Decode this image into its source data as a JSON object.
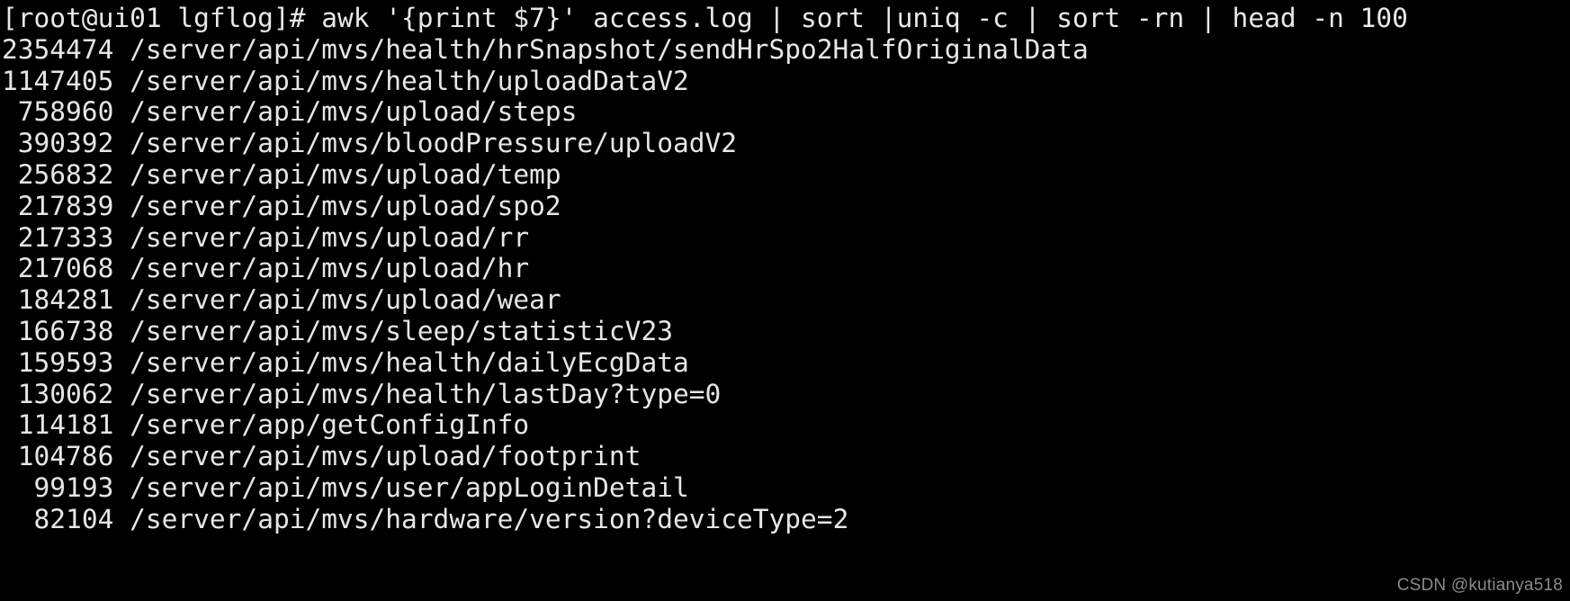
{
  "terminal": {
    "prompt": "[root@ui01 lgflog]#",
    "command": "awk '{print $7}' access.log | sort |uniq -c | sort -rn | head -n 100",
    "command_line": "[root@ui01 lgflog]# awk '{print $7}' access.log | sort |uniq -c | sort -rn | head -n 100",
    "count_width": 7,
    "rows": [
      {
        "count": "2354474",
        "path": "/server/api/mvs/health/hrSnapshot/sendHrSpo2HalfOriginalData"
      },
      {
        "count": "1147405",
        "path": "/server/api/mvs/health/uploadDataV2"
      },
      {
        "count": "758960",
        "path": "/server/api/mvs/upload/steps"
      },
      {
        "count": "390392",
        "path": "/server/api/mvs/bloodPressure/uploadV2"
      },
      {
        "count": "256832",
        "path": "/server/api/mvs/upload/temp"
      },
      {
        "count": "217839",
        "path": "/server/api/mvs/upload/spo2"
      },
      {
        "count": "217333",
        "path": "/server/api/mvs/upload/rr"
      },
      {
        "count": "217068",
        "path": "/server/api/mvs/upload/hr"
      },
      {
        "count": "184281",
        "path": "/server/api/mvs/upload/wear"
      },
      {
        "count": "166738",
        "path": "/server/api/mvs/sleep/statisticV23"
      },
      {
        "count": "159593",
        "path": "/server/api/mvs/health/dailyEcgData"
      },
      {
        "count": "130062",
        "path": "/server/api/mvs/health/lastDay?type=0"
      },
      {
        "count": "114181",
        "path": "/server/app/getConfigInfo"
      },
      {
        "count": "104786",
        "path": "/server/api/mvs/upload/footprint"
      },
      {
        "count": "99193",
        "path": "/server/api/mvs/user/appLoginDetail"
      },
      {
        "count": "82104",
        "path": "/server/api/mvs/hardware/version?deviceType=2"
      }
    ]
  },
  "watermark": {
    "text": "CSDN @kutianya518"
  },
  "colors": {
    "background": "#000000",
    "foreground": "#e6e6e6",
    "watermark": "#8a8a8a"
  }
}
